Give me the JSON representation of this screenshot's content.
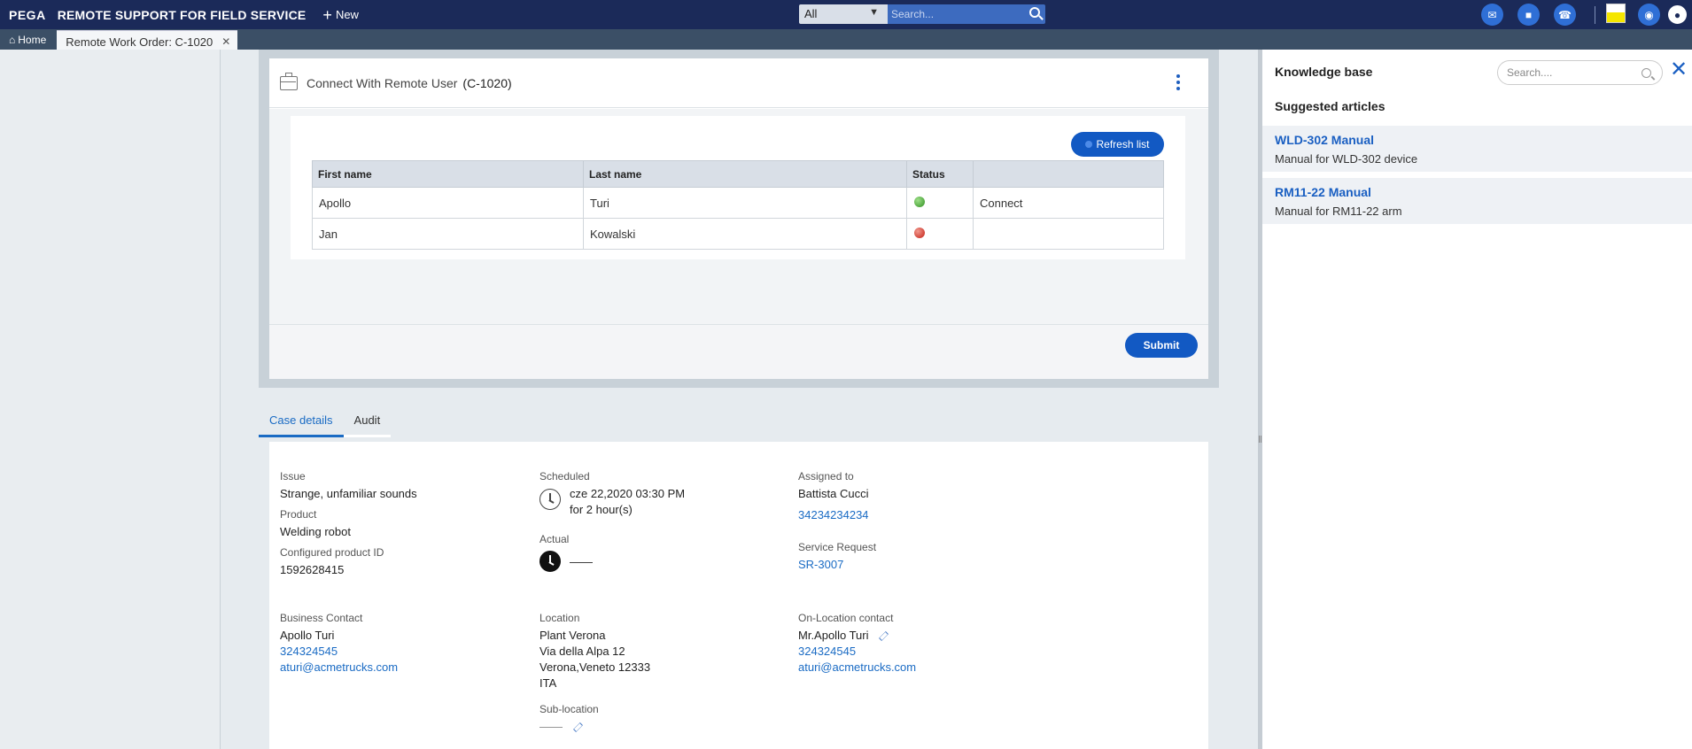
{
  "topbar": {
    "logo": "PEGA",
    "app_title": "REMOTE SUPPORT FOR FIELD SERVICE",
    "new_label": "New",
    "search_scope": "All",
    "search_placeholder": "Search..."
  },
  "tabs": {
    "home": "Home",
    "work_tab": "Remote Work Order: C-1020"
  },
  "assignment": {
    "title": "Connect With Remote User",
    "case_id": "(C-1020)",
    "refresh_label": "Refresh list",
    "columns": [
      "First name",
      "Last name",
      "Status",
      ""
    ],
    "rows": [
      {
        "first": "Apollo",
        "last": "Turi",
        "status": "online",
        "action": "Connect"
      },
      {
        "first": "Jan",
        "last": "Kowalski",
        "status": "offline",
        "action": ""
      }
    ],
    "submit_label": "Submit",
    "status_colors": {
      "online": "#2f8f1f",
      "offline": "#c21d12"
    }
  },
  "case_tabs": [
    "Case details",
    "Audit"
  ],
  "details": {
    "issue_label": "Issue",
    "issue": "Strange, unfamiliar sounds",
    "product_label": "Product",
    "product": "Welding robot",
    "config_label": "Configured product ID",
    "config_id": "1592628415",
    "scheduled_label": "Scheduled",
    "scheduled_date": "cze 22,2020 03:30 PM",
    "scheduled_duration": "for  2 hour(s)",
    "actual_label": "Actual",
    "actual_value": "——",
    "assigned_label": "Assigned to",
    "assigned_name": "Battista Cucci",
    "assigned_phone": "34234234234",
    "sr_label": "Service Request",
    "sr_value": "SR-3007",
    "bc_label": "Business Contact",
    "bc_name": "Apollo Turi",
    "bc_phone": "324324545",
    "bc_email": "aturi@acmetrucks.com",
    "loc_label": "Location",
    "loc_line1": "Plant Verona",
    "loc_line2": "Via della Alpa 12",
    "loc_line3": "Verona,Veneto 12333",
    "loc_line4": "ITA",
    "subloc_label": "Sub-location",
    "subloc_value": "——",
    "olc_label": "On-Location contact",
    "olc_name": "Mr.Apollo Turi",
    "olc_phone": "324324545",
    "olc_email": "aturi@acmetrucks.com"
  },
  "knowledge": {
    "title": "Knowledge base",
    "search_placeholder": "Search....",
    "suggested_title": "Suggested articles",
    "articles": [
      {
        "title": "WLD-302 Manual",
        "desc": "Manual for WLD-302 device"
      },
      {
        "title": "RM11-22 Manual",
        "desc": "Manual for RM11-22 arm"
      }
    ]
  },
  "colors": {
    "topbar": "#1b2a59",
    "accent": "#1259c3",
    "link": "#1a6bc4"
  }
}
